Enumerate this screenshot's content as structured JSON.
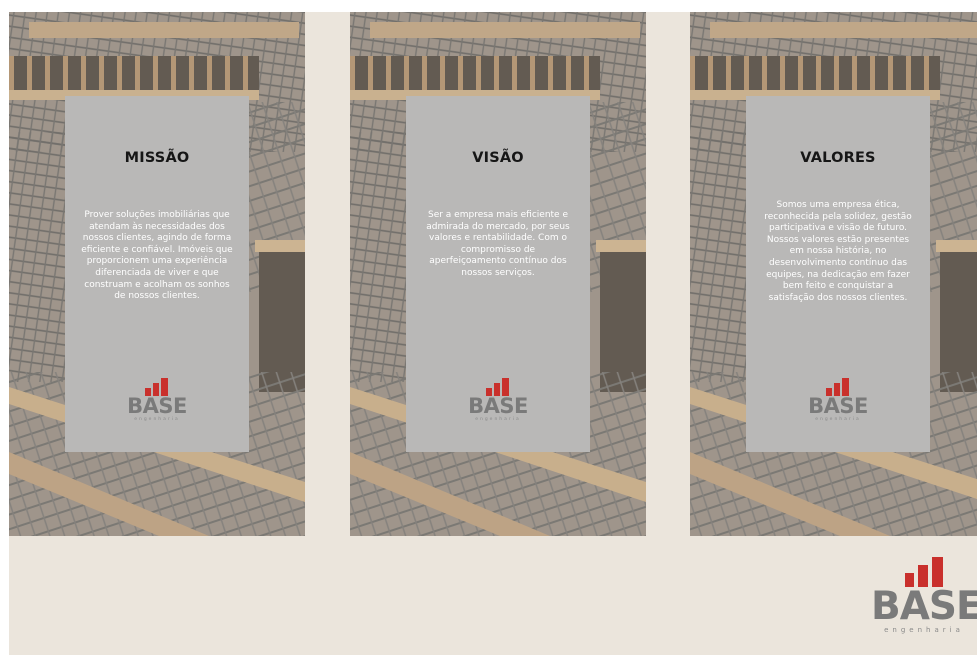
{
  "brand": {
    "name": "BASE",
    "tagline": "engenharia",
    "accent_color": "#c9302c"
  },
  "cards": [
    {
      "title": "MISSÃO",
      "text": "Prover soluções imobiliárias que atendam às necessidades dos nossos clientes, agindo de forma eficiente e confiável. Imóveis que proporcionem uma experiência diferenciada de viver e que construam e acolham os sonhos de nossos clientes."
    },
    {
      "title": "VISÃO",
      "text": "Ser a empresa mais eficiente e admirada do mercado, por seus valores e rentabilidade. Com o compromisso de aperfeiçoamento contínuo dos nossos serviços."
    },
    {
      "title": "VALORES",
      "text": "Somos uma empresa ética, reconhecida pela solidez, gestão participativa e visão de futuro. Nossos valores estão presentes em nossa história, no desenvolvimento contínuo das equipes, na dedicação em fazer bem feito e conquistar a satisfação dos nossos clientes."
    }
  ],
  "background_image": "construction-rebar-photo"
}
